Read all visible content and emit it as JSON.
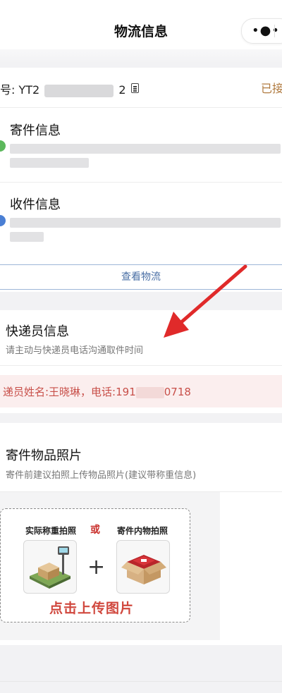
{
  "header": {
    "title": "物流信息",
    "menu_icon": "more-dots-icon"
  },
  "order": {
    "label_partial": "号: YT2",
    "number_visible_suffix": "2",
    "copy_icon": "document-icon",
    "status_partial": "已接"
  },
  "sender": {
    "title": "寄件信息",
    "icon_color": "#5cb85c"
  },
  "receiver": {
    "title": "收件信息",
    "icon_color": "#4a7fd4"
  },
  "track_button": {
    "label": "查看物流"
  },
  "courier": {
    "title": "快递员信息",
    "subtitle": "请主动与快递员电话沟通取件时间",
    "info_prefix": "递员姓名:王晓琳，电话:191",
    "phone_suffix": "0718"
  },
  "photos": {
    "title": "寄件物品照片",
    "subtitle": "寄件前建议拍照上传物品照片(建议带称重信息)",
    "option_left": "实际称重拍照",
    "or_label": "或",
    "option_right": "寄件内物拍照",
    "upload_label": "点击上传图片"
  },
  "colors": {
    "accent_brown": "#b07a3f",
    "link_blue": "#4a6fa5",
    "alert_red": "#c8504a",
    "annotation_arrow": "#e02a2a"
  }
}
